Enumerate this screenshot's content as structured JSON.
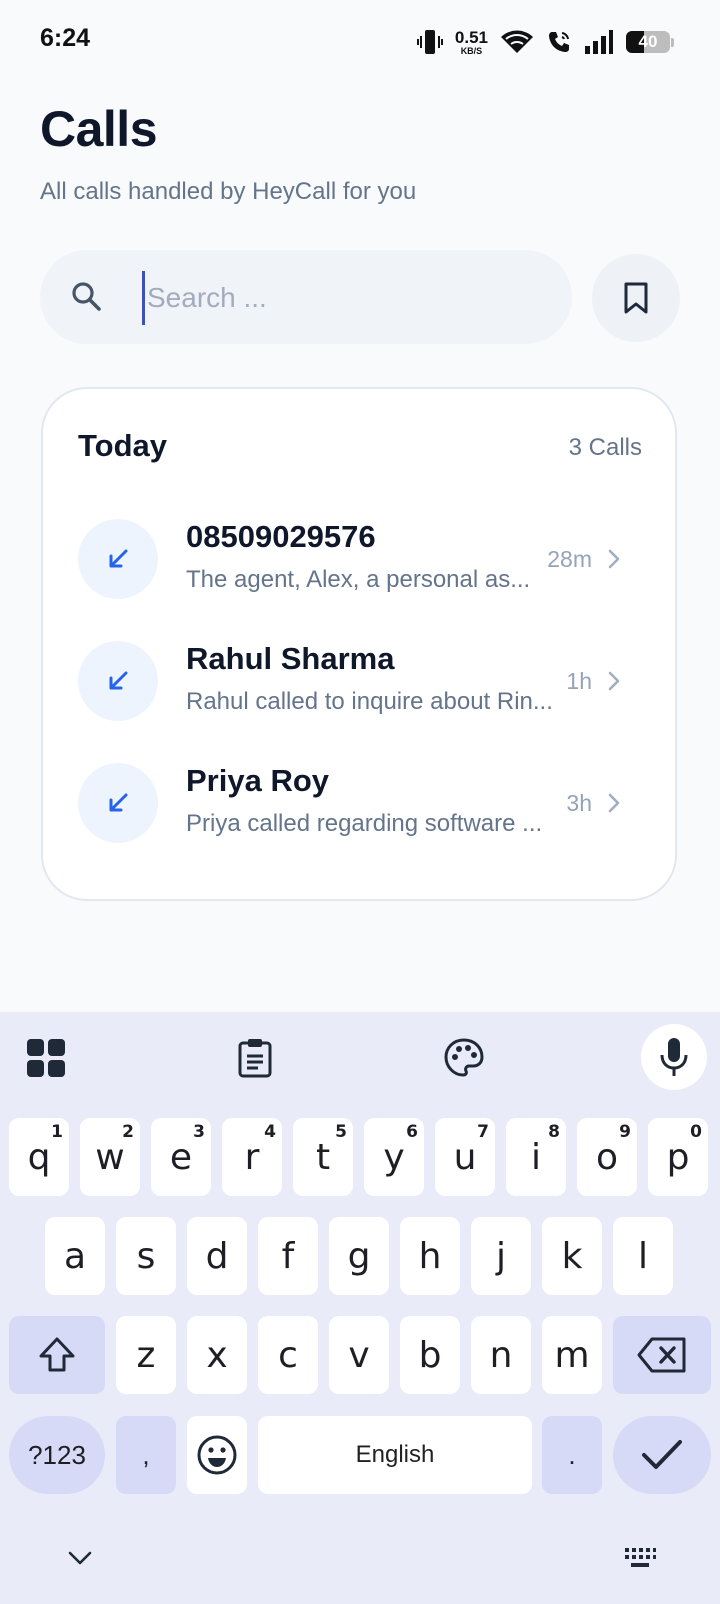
{
  "status_bar": {
    "time": "6:24",
    "net_speed_value": "0.51",
    "net_speed_unit": "KB/S",
    "battery_level": "40",
    "icons": [
      "vibrate-icon",
      "wifi-icon",
      "wifi-calling-icon",
      "signal-icon",
      "battery-icon"
    ]
  },
  "header": {
    "title": "Calls",
    "subtitle": "All calls handled by HeyCall for you"
  },
  "search": {
    "value": "",
    "placeholder": "Search ..."
  },
  "section": {
    "title": "Today",
    "count_label": "3 Calls"
  },
  "calls": [
    {
      "name": "08509029576",
      "summary": "The agent, Alex, a personal as...",
      "time": "28m",
      "direction": "incoming"
    },
    {
      "name": "Rahul Sharma",
      "summary": "Rahul called to inquire about Rin...",
      "time": "1h",
      "direction": "incoming"
    },
    {
      "name": "Priya Roy",
      "summary": "Priya called regarding software ...",
      "time": "3h",
      "direction": "incoming"
    }
  ],
  "keyboard": {
    "row1": [
      {
        "k": "q",
        "h": "1"
      },
      {
        "k": "w",
        "h": "2"
      },
      {
        "k": "e",
        "h": "3"
      },
      {
        "k": "r",
        "h": "4"
      },
      {
        "k": "t",
        "h": "5"
      },
      {
        "k": "y",
        "h": "6"
      },
      {
        "k": "u",
        "h": "7"
      },
      {
        "k": "i",
        "h": "8"
      },
      {
        "k": "o",
        "h": "9"
      },
      {
        "k": "p",
        "h": "0"
      }
    ],
    "row2": [
      "a",
      "s",
      "d",
      "f",
      "g",
      "h",
      "j",
      "k",
      "l"
    ],
    "row3": [
      "z",
      "x",
      "c",
      "v",
      "b",
      "n",
      "m"
    ],
    "symbols_label": "?123",
    "comma_label": ",",
    "space_label": "English",
    "period_label": ".",
    "accent_color": "#d6daf6",
    "background_color": "#e9ebf8"
  }
}
